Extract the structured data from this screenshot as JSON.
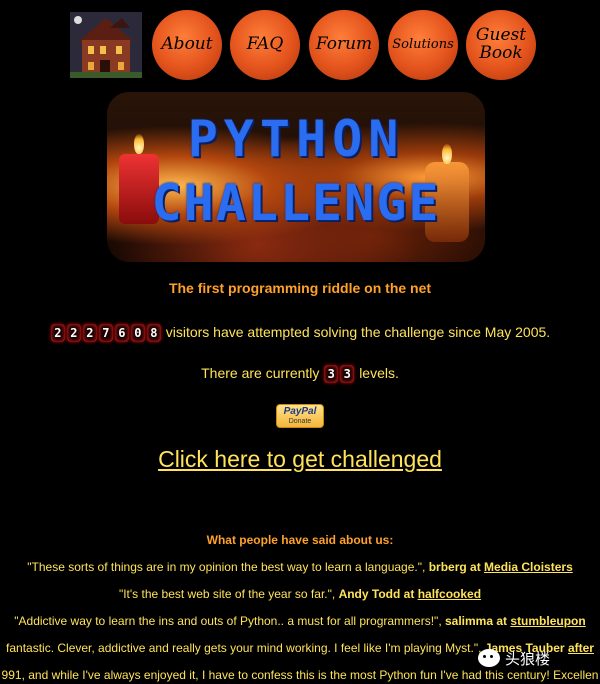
{
  "nav": {
    "about": "About",
    "faq": "FAQ",
    "forum": "Forum",
    "solutions": "Solutions",
    "guest_line1": "Guest",
    "guest_line2": "Book"
  },
  "banner": {
    "title_line1": "PYTHON",
    "title_line2": "CHALLENGE"
  },
  "tagline": "The first programming riddle on the net",
  "visitors": {
    "counter_digits": [
      "2",
      "2",
      "2",
      "7",
      "6",
      "0",
      "8"
    ],
    "text": "visitors have attempted solving the challenge since May 2005."
  },
  "levels": {
    "prefix": "There are currently",
    "count_digits": [
      "3",
      "3"
    ],
    "suffix": "levels."
  },
  "donate": {
    "logo": "PayPal",
    "label": "Donate"
  },
  "challenge_link": "Click here to get challenged",
  "testimonials": {
    "header": "What people have said about us:",
    "quotes": [
      {
        "text": "\"These sorts of things are in my opinion the best way to learn a language.\",",
        "who": "brberg at",
        "site": "Media Cloisters"
      },
      {
        "text": "\"It's the best web site of the year so far.\",",
        "who": "Andy Todd at",
        "site": "halfcooked"
      },
      {
        "text": "\"Addictive way to learn the ins and outs of Python.. a must for all programmers!\",",
        "who": "salimma at",
        "site": "stumbleupon"
      },
      {
        "text": "fantastic. Clever, addictive and really gets your mind working. I feel like I'm playing Myst.\",",
        "who": "James Tauber",
        "site": "after"
      },
      {
        "text": "991, and while I've always enjoyed it, I have to confess this is the most Python fun I've had this century! Excellen",
        "who": "",
        "site": ""
      }
    ]
  },
  "watermark": "头狼楼"
}
